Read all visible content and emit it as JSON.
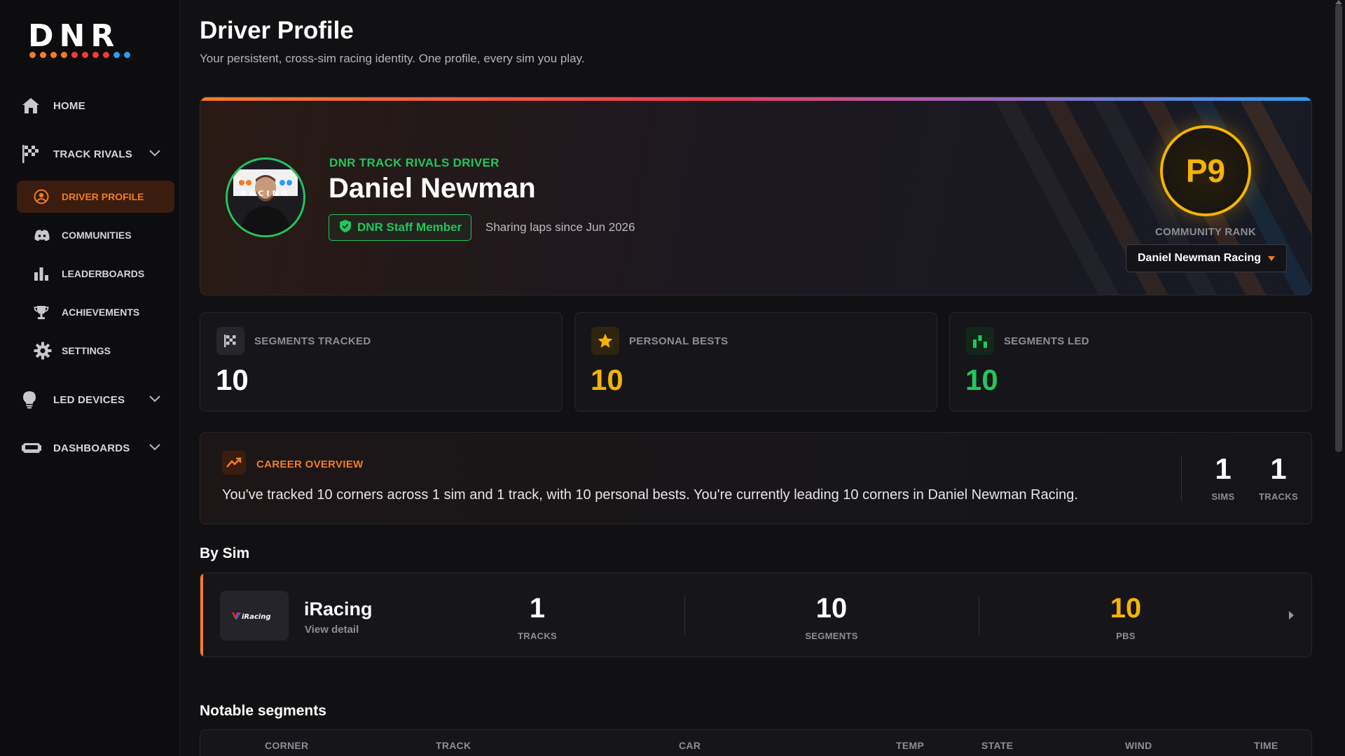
{
  "brand": {
    "logo_text": "DNR",
    "dot_colors": [
      "#f47c27",
      "#f47c27",
      "#f47c27",
      "#f47c27",
      "#ee3c3c",
      "#ee3c3c",
      "#ee3c3c",
      "#ee3c3c",
      "#2a9df4",
      "#2a9df4"
    ]
  },
  "sidebar": {
    "home": "HOME",
    "track_rivals": "TRACK RIVALS",
    "driver_profile": "DRIVER PROFILE",
    "communities": "COMMUNITIES",
    "leaderboards": "LEADERBOARDS",
    "achievements": "ACHIEVEMENTS",
    "settings": "SETTINGS",
    "led_devices": "LED DEVICES",
    "dashboards": "DASHBOARDS"
  },
  "header": {
    "title": "Driver Profile",
    "subtitle": "Your persistent, cross-sim racing identity. One profile, every sim you play."
  },
  "hero": {
    "tag": "DNR TRACK RIVALS DRIVER",
    "name": "Daniel Newman",
    "badge": "DNR Staff Member",
    "since": "Sharing laps since Jun 2026",
    "rank": "P9",
    "rank_label": "COMMUNITY RANK",
    "community_selected": "Daniel Newman Racing",
    "avatar_shirt_text": "RACING"
  },
  "stats": [
    {
      "label": "SEGMENTS TRACKED",
      "value": "10",
      "color": "#ffffff",
      "icon": "checkered-flag-icon"
    },
    {
      "label": "PERSONAL BESTS",
      "value": "10",
      "color": "#f5b400",
      "icon": "star-icon"
    },
    {
      "label": "SEGMENTS LED",
      "value": "10",
      "color": "#22c55e",
      "icon": "podium-icon"
    }
  ],
  "career": {
    "label": "CAREER OVERVIEW",
    "text": "You've tracked 10 corners across 1 sim and 1 track, with 10 personal bests. You're currently leading 10 corners in Daniel Newman Racing.",
    "sims_value": "1",
    "sims_label": "SIMS",
    "tracks_value": "1",
    "tracks_label": "TRACKS"
  },
  "by_sim": {
    "title": "By Sim",
    "rows": [
      {
        "name": "iRacing",
        "logo_text": "iRacing",
        "link": "View detail",
        "tracks_value": "1",
        "tracks_label": "TRACKS",
        "segments_value": "10",
        "segments_label": "SEGMENTS",
        "pbs_value": "10",
        "pbs_label": "PBS"
      }
    ]
  },
  "notable": {
    "title": "Notable segments",
    "columns": [
      "CORNER",
      "TRACK",
      "CAR",
      "TEMP",
      "STATE",
      "WIND",
      "TIME"
    ]
  },
  "colors": {
    "accent": "#f47c27",
    "green": "#22c55e",
    "gold": "#f5b400",
    "blue": "#2a9df4"
  }
}
